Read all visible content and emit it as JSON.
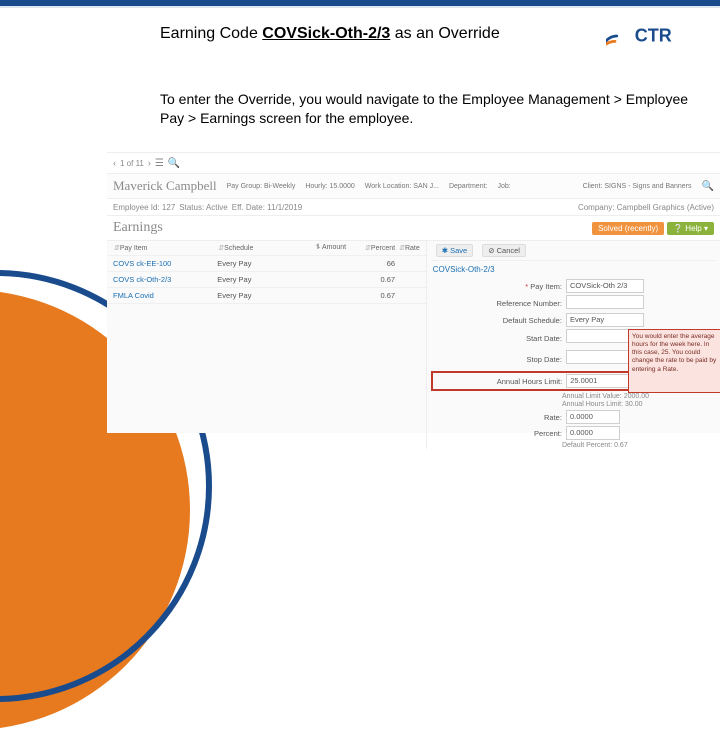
{
  "slide": {
    "title_pre": "Earning Code ",
    "title_code": "COVSick-Oth-2/3",
    "title_post": " as an Override",
    "body": "To enter the Override, you would navigate to the Employee Management > Employee Pay > Earnings screen for the employee.",
    "logo_text": "CTR"
  },
  "crumb": {
    "pager": "1 of 11"
  },
  "employee": {
    "name": "Maverick Campbell",
    "id_label": "Employee Id: 127",
    "status_label": "Status: Active",
    "paygroup": "Pay Group: Bi-Weekly",
    "hourly": "Hourly: 15.0000",
    "eff": "Eff. Date: 11/1/2019",
    "workloc": "Work Location: SAN J...",
    "department": "Department:",
    "job": "Job:",
    "client": "Client: SIGNS - Signs and Banners",
    "company": "Company: Campbell Graphics (Active)"
  },
  "earnings": {
    "heading": "Earnings",
    "solved_btn": "Solved (recently)",
    "help_btn": "Help",
    "cols": {
      "pay_item": "Pay Item",
      "schedule": "Schedule",
      "amount": "Amount",
      "percent": "Percent",
      "rate": "Rate"
    },
    "rows": [
      {
        "pay_item": "COVS ck-EE-100",
        "schedule": "Every Pay",
        "amount": "",
        "percent": "66",
        "rate": ""
      },
      {
        "pay_item": "COVS ck-Oth-2/3",
        "schedule": "Every Pay",
        "amount": "",
        "percent": "0.67",
        "rate": ""
      },
      {
        "pay_item": "FMLA Covid",
        "schedule": "Every Pay",
        "amount": "",
        "percent": "0.67",
        "rate": ""
      }
    ]
  },
  "form": {
    "save": "Save",
    "cancel": "Cancel",
    "title": "COVSick-Oth-2/3",
    "fields": {
      "pay_item_label": "Pay Item:",
      "pay_item_value": "COVSick-Oth 2/3",
      "reference_label": "Reference Number:",
      "schedule_label": "Default Schedule:",
      "schedule_value": "Every Pay",
      "start_label": "Start Date:",
      "stop_label": "Stop Date:",
      "annual_hours_label": "Annual Hours Limit:",
      "annual_hours_value": "25.0001",
      "annual_limit_value_label": "Annual Limit Value: 2000.00",
      "annual_hours_limit_static": "Annual Hours Limit: 30.00",
      "rate_label": "Rate:",
      "rate_value": "0.0000",
      "percent_label": "Percent:",
      "percent_value": "0.0000",
      "default_percent_label": "Default Percent: 0.67"
    }
  },
  "callout": "You would enter the average hours for the week here. In this case, 25. You could change the rate to be paid by entering a Rate."
}
